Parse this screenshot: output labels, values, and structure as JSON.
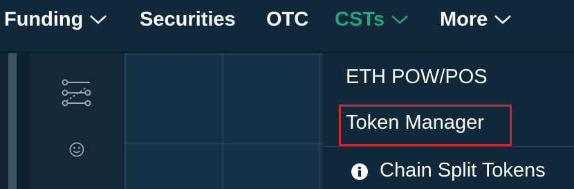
{
  "nav": {
    "items": [
      {
        "label": "Funding",
        "has_dropdown": true
      },
      {
        "label": "Securities",
        "has_dropdown": false
      },
      {
        "label": "OTC",
        "has_dropdown": false
      },
      {
        "label": "CSTs",
        "has_dropdown": true,
        "active": true
      },
      {
        "label": "More",
        "has_dropdown": true
      }
    ]
  },
  "dropdown": {
    "items": [
      {
        "label": "ETH POW/POS"
      },
      {
        "label": "Token Manager",
        "highlighted": true
      },
      {
        "label": "Chain Split Tokens",
        "icon": "info-icon"
      }
    ]
  },
  "toolbar": {
    "icons": [
      "filter-settings-icon",
      "smiley-icon"
    ]
  },
  "colors": {
    "nav_bg": "#10283a",
    "body_bg": "#132d40",
    "active": "#1fa67a",
    "highlight_border": "#d6252b"
  }
}
